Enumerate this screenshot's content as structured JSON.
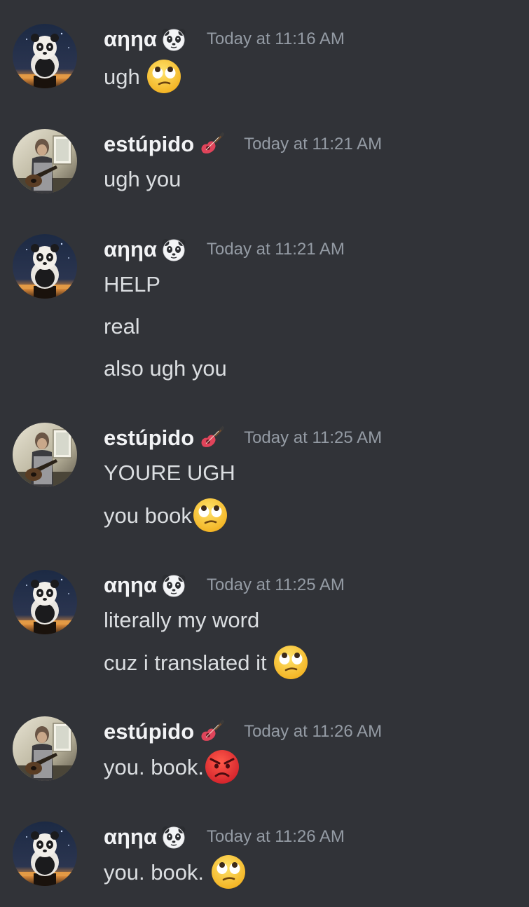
{
  "messages": [
    {
      "author": "αηηα",
      "author_badge": "panda-icon",
      "timestamp": "Today at 11:16 AM",
      "lines": [
        {
          "text": "ugh ",
          "emoji": "eye-roll-emoji"
        }
      ]
    },
    {
      "author": "estúpido",
      "author_badge": "guitar-icon",
      "timestamp": "Today at 11:21 AM",
      "lines": [
        {
          "text": "ugh you"
        }
      ]
    },
    {
      "author": "αηηα",
      "author_badge": "panda-icon",
      "timestamp": "Today at 11:21 AM",
      "lines": [
        {
          "text": "HELP"
        },
        {
          "text": "real"
        },
        {
          "text": "also ugh you"
        }
      ]
    },
    {
      "author": "estúpido",
      "author_badge": "guitar-icon",
      "timestamp": "Today at 11:25 AM",
      "lines": [
        {
          "text": "YOURE UGH"
        },
        {
          "text": "you book",
          "emoji": "eye-roll-emoji"
        }
      ]
    },
    {
      "author": "αηηα",
      "author_badge": "panda-icon",
      "timestamp": "Today at 11:25 AM",
      "lines": [
        {
          "text": "literally my word"
        },
        {
          "text": "cuz i translated it ",
          "emoji": "eye-roll-emoji"
        }
      ]
    },
    {
      "author": "estúpido",
      "author_badge": "guitar-icon",
      "timestamp": "Today at 11:26 AM",
      "lines": [
        {
          "text": "you. book.",
          "emoji": "angry-face-emoji"
        }
      ]
    },
    {
      "author": "αηηα",
      "author_badge": "panda-icon",
      "timestamp": "Today at 11:26 AM",
      "lines": [
        {
          "text": "you. book. ",
          "emoji": "eye-roll-emoji"
        }
      ]
    }
  ],
  "colors": {
    "background": "#313338",
    "username": "#f2f3f5",
    "message_text": "#dbdee1",
    "timestamp": "#949ba4"
  }
}
